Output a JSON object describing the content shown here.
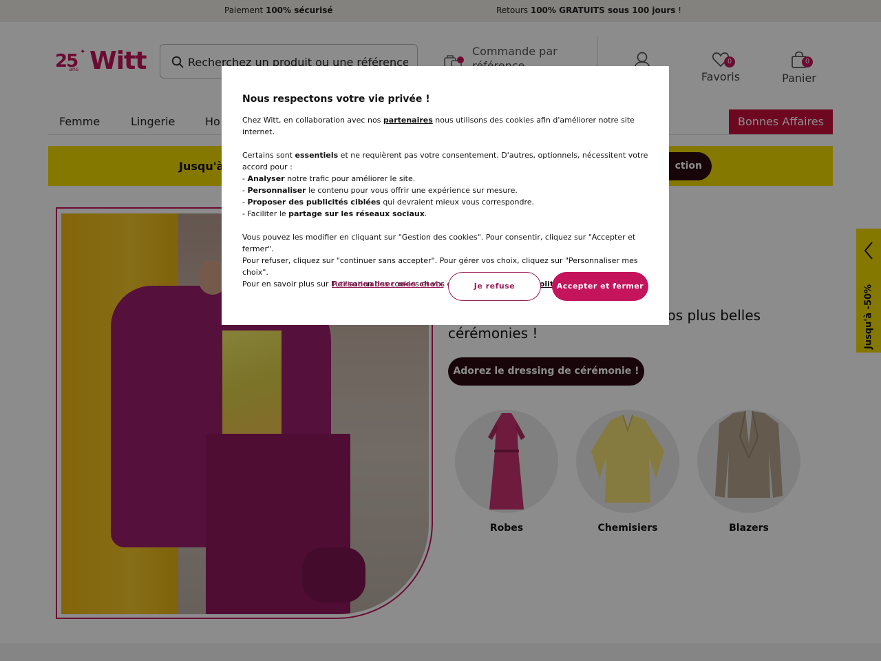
{
  "topbar": {
    "left": {
      "plain": "Paiement ",
      "bold": "100% sécurisé"
    },
    "right": {
      "plain": "Retours ",
      "bold": "100% GRATUITS sous 100 jours",
      "tail": " !"
    }
  },
  "logo": {
    "anniversary": "25",
    "ans": "ans",
    "brand": "Witt"
  },
  "search": {
    "placeholder": "Recherchez un produit ou une référence"
  },
  "order_ref": {
    "label": "Commande par référence"
  },
  "header": {
    "favorites": {
      "label": "Favoris",
      "count": "0"
    },
    "cart": {
      "label": "Panier",
      "count": "0"
    }
  },
  "nav": {
    "items": [
      "Femme",
      "Lingerie",
      "Ho"
    ],
    "deals": "Bonnes Affaires"
  },
  "promo": {
    "text": "Jusqu'à",
    "button": "ction"
  },
  "hero": {
    "text": "ue parfaite pour briller lors de vos plus belles cérémonies !",
    "cta": "Adorez le dressing de cérémonie !",
    "categories": [
      "Robes",
      "Chemisiers",
      "Blazers"
    ]
  },
  "side_tab": {
    "label": "Jusqu'à -50%"
  },
  "cookie_modal": {
    "title": "Nous respectons votre vie privée !",
    "intro_before": "Chez Witt, en collaboration avec nos ",
    "intro_link": "partenaires",
    "intro_after": " nous utilisons des cookies afin d'améliorer notre site internet.",
    "p2_before": "Certains sont ",
    "p2_bold": "essentiels",
    "p2_after": " et ne requièrent pas votre consentement. D'autres, optionnels, nécessitent votre accord pour :",
    "bullets": [
      {
        "bold": "Analyser",
        "text": " notre trafic pour améliorer le site."
      },
      {
        "bold": "Personnaliser",
        "text": " le contenu pour vous offrir une expérience sur mesure."
      },
      {
        "bold": "Proposer des publicités ciblées",
        "text": " qui devraient mieux vous correspondre."
      }
    ],
    "bullet4_before": "Faciliter le ",
    "bullet4_bold": "partage sur les réseaux sociaux",
    "bullet4_after": ".",
    "p3_line1": "Vous pouvez les modifier en cliquant sur \"Gestion des cookies\". Pour consentir, cliquez sur \"Accepter et fermer\".",
    "p3_line2": "Pour refuser, cliquez sur \"continuer sans accepter\". Pour gérer vos choix, cliquez sur \"Personnaliser mes choix\".",
    "p3_line3_before": "Pour en savoir plus sur l'utilisation des cookies et vos droits, consultez notre ",
    "p3_link": "politique des cookies",
    "p3_after": ".",
    "personalize": "Personnaliser mes choix",
    "refuse": "Je refuse",
    "accept": "Accepter et fermer"
  },
  "colors": {
    "brand": "#c3145c",
    "deals": "#c8103d",
    "promo": "#f2da00",
    "dark": "#2b0a12"
  }
}
